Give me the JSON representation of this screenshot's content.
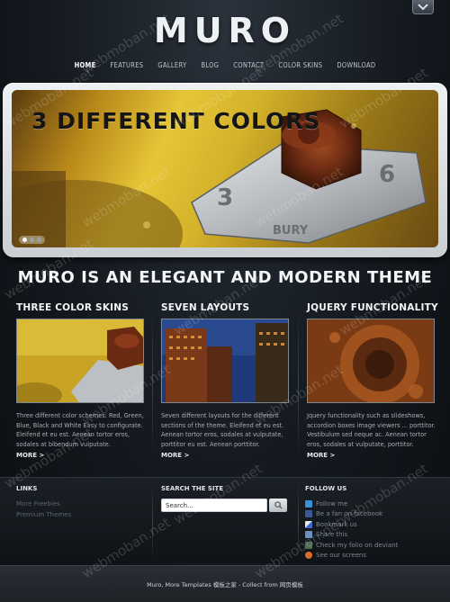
{
  "brand": {
    "logo": "MURO"
  },
  "nav": {
    "items": [
      "HOME",
      "FEATURES",
      "GALLERY",
      "BLOG",
      "CONTACT",
      "COLOR SKINS",
      "DOWNLOAD"
    ],
    "active": "HOME"
  },
  "slider": {
    "caption": "3 DIFFERENT COLORS",
    "total_slides": 3,
    "current_slide": 1
  },
  "tagline": "MURO IS AN ELEGANT AND MODERN THEME",
  "features": [
    {
      "title": "THREE COLOR SKINS",
      "text": "Three different color schemes: Red, Green, Blue, Black and White Easy to configurate. Eleifend et eu est. Aenean tortor eros, sodales at bibendum vulputate.",
      "more": "MORE >"
    },
    {
      "title": "SEVEN LAYOUTS",
      "text": "Seven different layouts for the different sections of the theme. Eleifend et eu est. Aenean tortor eros, sodales at vulputate, porttitor eu est. Aenean porttitor.",
      "more": "MORE >"
    },
    {
      "title": "JQUERY FUNCTIONALITY",
      "text": "Jquery functionality such as slideshows, accordion boxes image viewers ... porttitor. Vestibulum sed neque ac. Aenean tortor eros, sodales at vulputate, porttitor.",
      "more": "MORE >"
    }
  ],
  "footer": {
    "links": {
      "title": "LINKS",
      "items": [
        "More Freebies",
        "Premium Themes"
      ]
    },
    "search": {
      "title": "SEARCH THE SITE",
      "placeholder": "Search..."
    },
    "follow": {
      "title": "FOLLOW US",
      "items": [
        {
          "label": "Follow me",
          "icon": "twitter-icon",
          "color": "#3a8fd6"
        },
        {
          "label": "Be a fan on facebook",
          "icon": "facebook-icon",
          "color": "#3b5998"
        },
        {
          "label": "Bookmark us",
          "icon": "delicious-icon",
          "color": "#e8e8e8"
        },
        {
          "label": "Share this",
          "icon": "share-icon",
          "color": "#6a8fc0"
        },
        {
          "label": "Check my folio on deviant",
          "icon": "deviantart-icon",
          "color": "#4e6b52"
        },
        {
          "label": "See our screens",
          "icon": "dribbble-icon",
          "color": "#d86a2a"
        }
      ]
    }
  },
  "copyright": "Muro, More Templates 模板之家 - Collect from 网页模板",
  "watermark": "webmoban.net",
  "colors": {
    "background": "#151a20",
    "slider_frame": "#e2e6e9",
    "accent_text": "#f2f4f6"
  }
}
